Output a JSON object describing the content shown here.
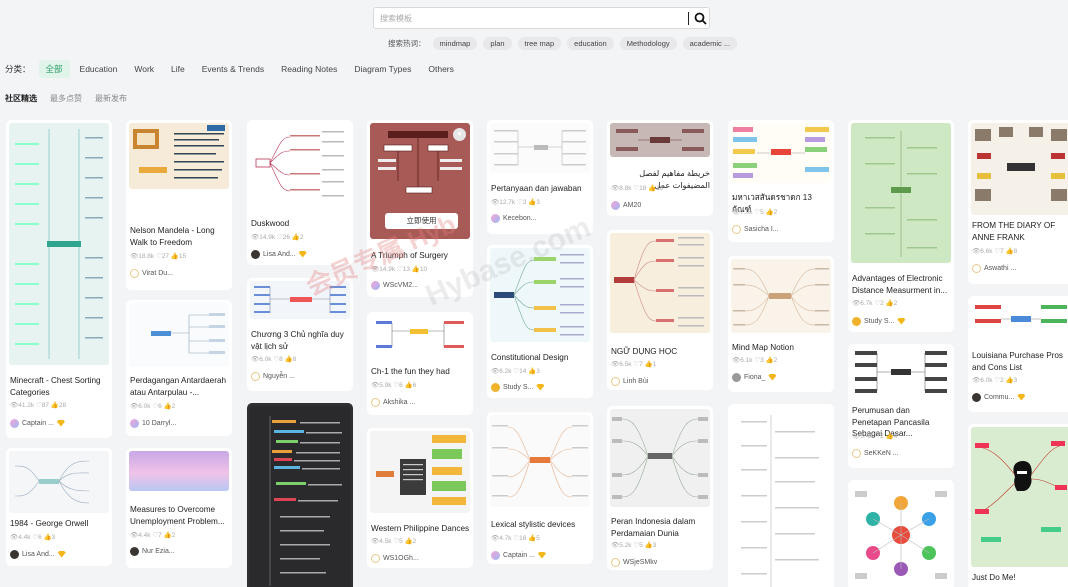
{
  "search": {
    "placeholder": "搜索模板"
  },
  "hot": {
    "label": "搜索热词：",
    "terms": [
      "mindmap",
      "plan",
      "tree map",
      "education",
      "Methodology",
      "academic ..."
    ]
  },
  "categories": {
    "label": "分类：",
    "items": [
      "全部",
      "Education",
      "Work",
      "Life",
      "Events & Trends",
      "Reading Notes",
      "Diagram Types",
      "Others"
    ]
  },
  "sorts": [
    "社区精选",
    "最多点赞",
    "最新发布"
  ],
  "overlay": {
    "use_label": "立即使用",
    "heart": "♥"
  },
  "cards": [
    {
      "title": "Minecraft - Chest Sorting Categories",
      "stats": "👁41.2k  ♡87  👍28",
      "author": "Captain ..."
    },
    {
      "title": "1984 - George Orwell",
      "stats": "👁4.4k  ♡6  👍3",
      "author": "Lisa And..."
    },
    {
      "title": "Nelson Mandela - Long Walk to Freedom",
      "stats": "👁18.8k  ♡27  👍15",
      "author": "Virat Du..."
    },
    {
      "title": "Perdagangan Antardaerah atau Antarpulau -...",
      "stats": "👁6.0k  ♡6  👍2",
      "author": "10 Darryl..."
    },
    {
      "title": "Measures to Overcome Unemployment Problem...",
      "stats": "👁4.4k  ♡7  👍2",
      "author": "Nur Ezia..."
    },
    {
      "title": "Duskwood",
      "stats": "👁14.9k  ♡26  👍2",
      "author": "Lisa And..."
    },
    {
      "title": "Chương 3 Chủ nghĩa duy vật lịch sử",
      "stats": "👁6.0k  ♡8  👍8",
      "author": "Nguyễn ..."
    },
    {
      "title": "A Triumph of Surgery",
      "stats": "👁14.9k  ♡13  👍10",
      "author": "WScVM2..."
    },
    {
      "title": "Ch-1 the fun they had",
      "stats": "👁5.9k  ♡6  👍6",
      "author": "Akshika ..."
    },
    {
      "title": "Western Philippine Dances",
      "stats": "👁4.5k  ♡5  👍2",
      "author": "WS1OGh..."
    },
    {
      "title": "Pertanyaan dan jawaban",
      "stats": "👁12.7k  ♡3  👍3",
      "author": "Kecebon..."
    },
    {
      "title": "Constitutional Design",
      "stats": "👁6.2k  ♡14  👍3",
      "author": "Study S..."
    },
    {
      "title": "Lexical stylistic devices",
      "stats": "👁4.7k  ♡16  👍5",
      "author": "Captain ..."
    },
    {
      "title": "خريطة مفاهيم لفصل المضيفوات عمل",
      "stats": "👁8.8k  ♡18  👍18",
      "author": "AM20"
    },
    {
      "title": "NGỮ DỤNG HỌC",
      "stats": "👁6.5k  ♡7  👍1",
      "author": "Linh Bùi"
    },
    {
      "title": "Peran Indonesia dalam Perdamaian Dunia",
      "stats": "👁5.2k  ♡5  👍3",
      "author": "WSjeSMkv"
    },
    {
      "title": "มหาเวสสันดรชาดก 13 กัณฑ์",
      "stats": "👁7.0k  ♡5  👍2",
      "author": "Sasicha I..."
    },
    {
      "title": "Mind Map Notion",
      "stats": "👁6.1k  ♡3  👍2",
      "author": "Fiona_"
    },
    {
      "title": "Advantages of Electronic Distance Measurment in...",
      "stats": "👁6.7k  ♡2  👍2",
      "author": "Study S..."
    },
    {
      "title": "Perumusan dan Penetapan Pancasila Sebagai Dasar...",
      "stats": "👁5.4k  ♡2  👍4",
      "author": "SeKKeN ..."
    },
    {
      "title": "FROM THE DIARY OF ANNE FRANK",
      "stats": "👁6.6k  ♡7  👍8",
      "author": "Aswathi ..."
    },
    {
      "title": "Louisiana Purchase Pros and Cons List",
      "stats": "👁6.0k  ♡2  👍3",
      "author": "Commu..."
    },
    {
      "title": "Just Do Me!",
      "stats": "",
      "author": ""
    }
  ],
  "colors": {
    "accent": "#2a9d64",
    "accent_bg": "#e1f4ea",
    "badge": "#f3b71b"
  },
  "watermark": {
    "text1": "会员专属 Hyb",
    "text2": "Hybase.com"
  }
}
